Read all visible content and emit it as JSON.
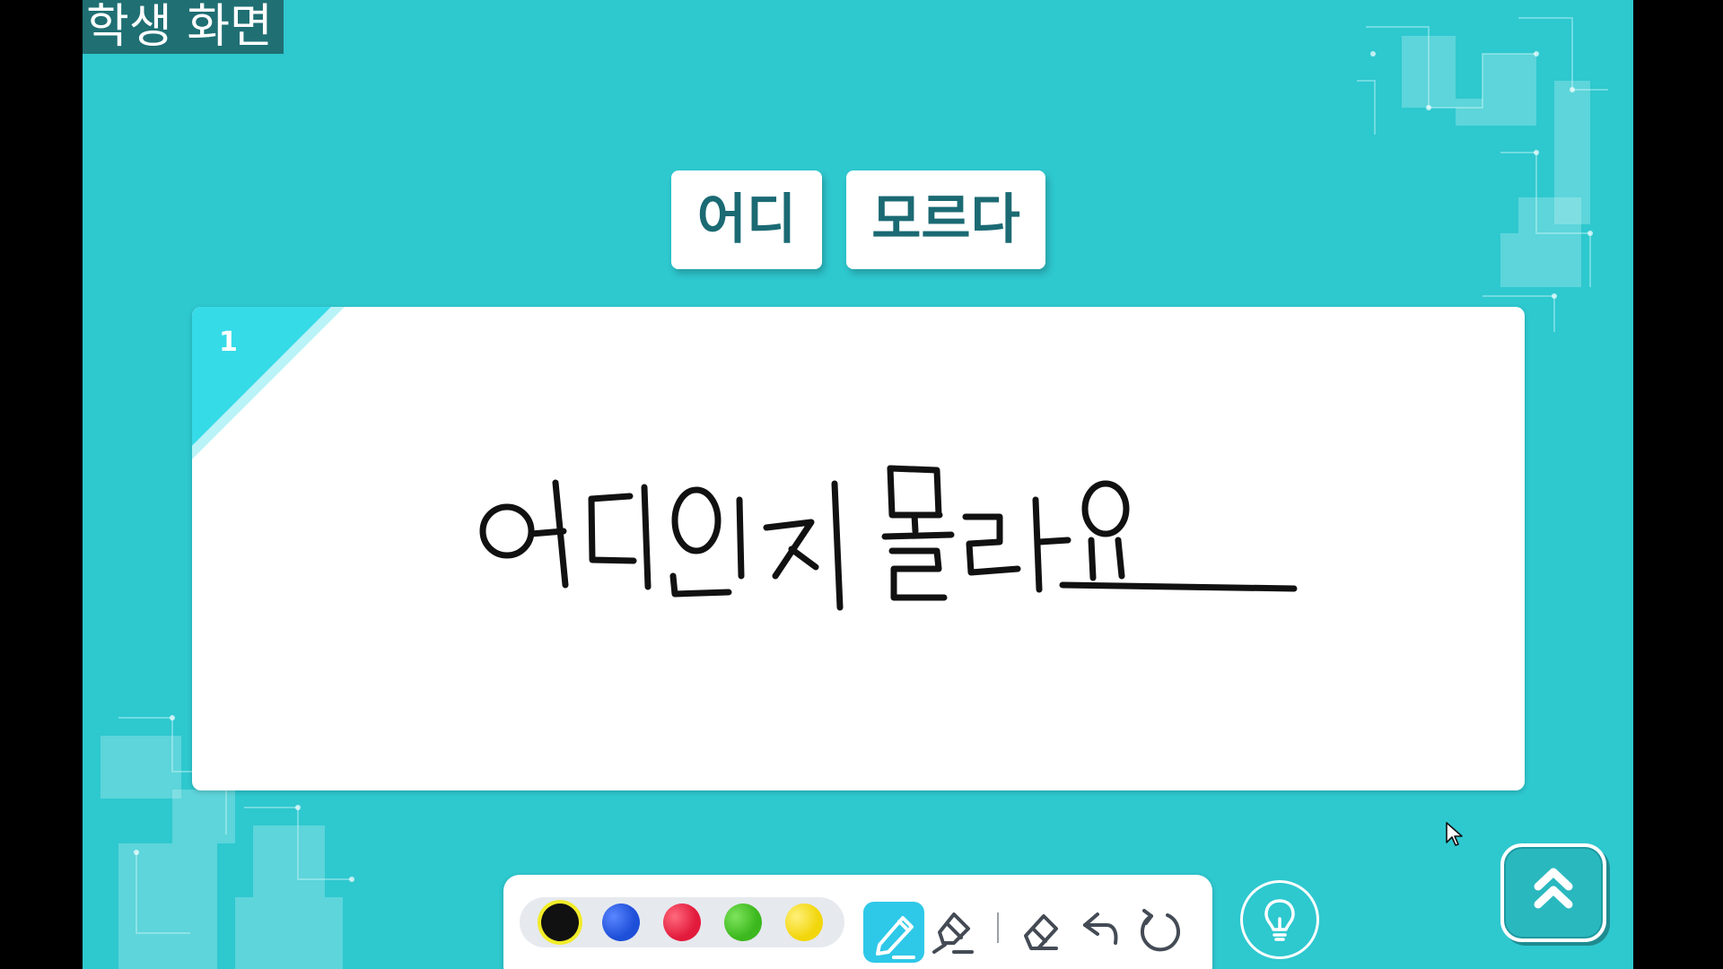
{
  "screen_label": "학생 화면",
  "word_cards": [
    {
      "label": "어디"
    },
    {
      "label": "모르다"
    }
  ],
  "writing_board": {
    "number": "1"
  },
  "toolbar": {
    "colors": [
      {
        "name": "black",
        "hex": "#111111",
        "selected": true
      },
      {
        "name": "blue",
        "hex": "#1e4fd8"
      },
      {
        "name": "red",
        "hex": "#e21b3c"
      },
      {
        "name": "green",
        "hex": "#3cb81e"
      },
      {
        "name": "yellow",
        "hex": "#f2d60c"
      }
    ],
    "tools": [
      "pen-icon",
      "highlighter-icon",
      "eraser-icon",
      "undo-icon",
      "reset-icon"
    ],
    "active_tool": "pen-icon"
  },
  "buttons": [
    "lightbulb-icon",
    "double-chevron-up-icon"
  ],
  "theme": {
    "background": "#2ec8cf",
    "accent": "#2ec8e8",
    "card_text": "#1b6a73"
  }
}
